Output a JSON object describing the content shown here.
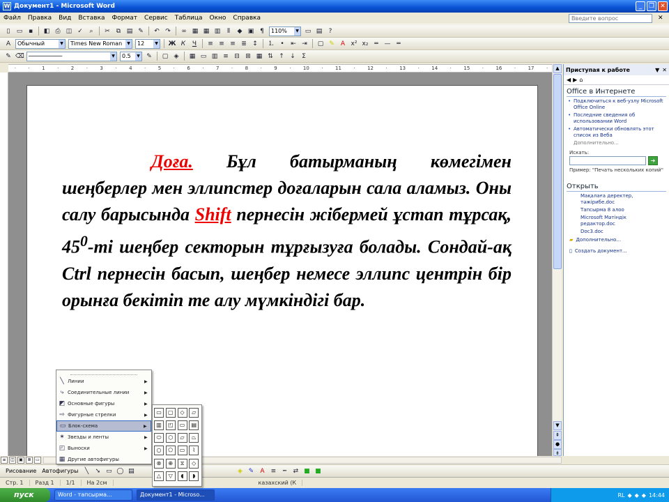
{
  "window": {
    "title": "Документ1 - Microsoft Word"
  },
  "menu": {
    "items": [
      "Файл",
      "Правка",
      "Вид",
      "Вставка",
      "Формат",
      "Сервис",
      "Таблица",
      "Окно",
      "Справка"
    ],
    "ask_placeholder": "Введите вопрос"
  },
  "toolbar": {
    "zoom": "110%",
    "style": "Обычный",
    "font": "Times New Roman",
    "size": "12",
    "line_width": "0.5"
  },
  "document": {
    "keyword1": "Доға.",
    "text1": " Бұл батырманың көмегімен шеңберлер мен эллипстер доғаларын сала аламыз. Оны салу барысында ",
    "keyword2": "Shift",
    "text2": " пернесін жібермей ұстап тұрсақ, 45",
    "sup": "0",
    "text3": "-ті шеңбер секторын тұрғызуға болады. Сондай-ақ Ctrl пернесін басып, шеңбер немесе эллипс центрін бір орынға бекітіп те алу мүмкіндігі бар."
  },
  "taskpane": {
    "title": "Приступая к работе",
    "section_office": "Office в Интернете",
    "links": [
      "Подключиться к веб-узлу Microsoft Office Online",
      "Последние сведения об использовании Word",
      "Автоматически обновлять этот список из Веба"
    ],
    "more": "Дополнительно...",
    "search_label": "Искать:",
    "example": "Пример: \"Печать нескольких копий\"",
    "section_open": "Открыть",
    "files": [
      "Мақалаға деректер, тәжірибе.doc",
      "Тапсырма 8 алоо",
      "Microsoft Мәтіндік редактор.doc",
      "Doc3.doc"
    ],
    "more_files": "Дополнительно...",
    "create": "Создать документ..."
  },
  "automenu": {
    "items": [
      "Линии",
      "Соединительные линии",
      "Основные фигуры",
      "Фигурные стрелки",
      "Блок-схема",
      "Звезды и ленты",
      "Выноски",
      "Другие автофигуры"
    ]
  },
  "drawbar": {
    "draw_label": "Рисование",
    "autoshapes_label": "Автофигуры"
  },
  "status": {
    "page": "Стр. 1",
    "section": "Разд 1",
    "pages": "1/1",
    "pos": "На 2см",
    "lang": "казахский (К"
  },
  "taskbar": {
    "start": "пуск",
    "tasks": [
      "Word - тапсырма...",
      "Документ1 - Microso..."
    ],
    "lang": "RL",
    "clock": "14:44"
  }
}
